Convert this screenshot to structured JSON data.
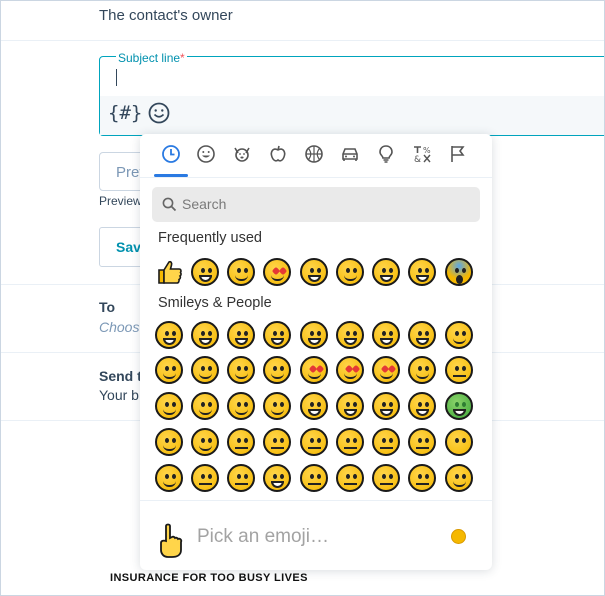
{
  "form": {
    "owner_text": "The contact's owner",
    "subject_label": "Subject line",
    "subject_required_mark": "*",
    "merge_tag_label": "{#}",
    "preview_placeholder": "Prev",
    "preview_help": "Preview",
    "save_label": "Save",
    "to_label": "To",
    "to_sub": "Choos",
    "send_label": "Send t",
    "send_sub": "Your b"
  },
  "picker": {
    "categories": [
      "recent-icon",
      "smileys-icon",
      "animals-icon",
      "food-icon",
      "activity-icon",
      "travel-icon",
      "objects-icon",
      "symbols-icon",
      "flags-icon"
    ],
    "search_placeholder": "Search",
    "frequent_title": "Frequently used",
    "smileys_title": "Smileys & People",
    "pick_placeholder": "Pick an emoji…"
  },
  "footer": {
    "text": "INSURANCE FOR TOO BUSY LIVES"
  },
  "colors": {
    "accent": "#00a4bd",
    "tab_underline": "#2a7ae2",
    "emoji_yellow": "#f5b800"
  }
}
